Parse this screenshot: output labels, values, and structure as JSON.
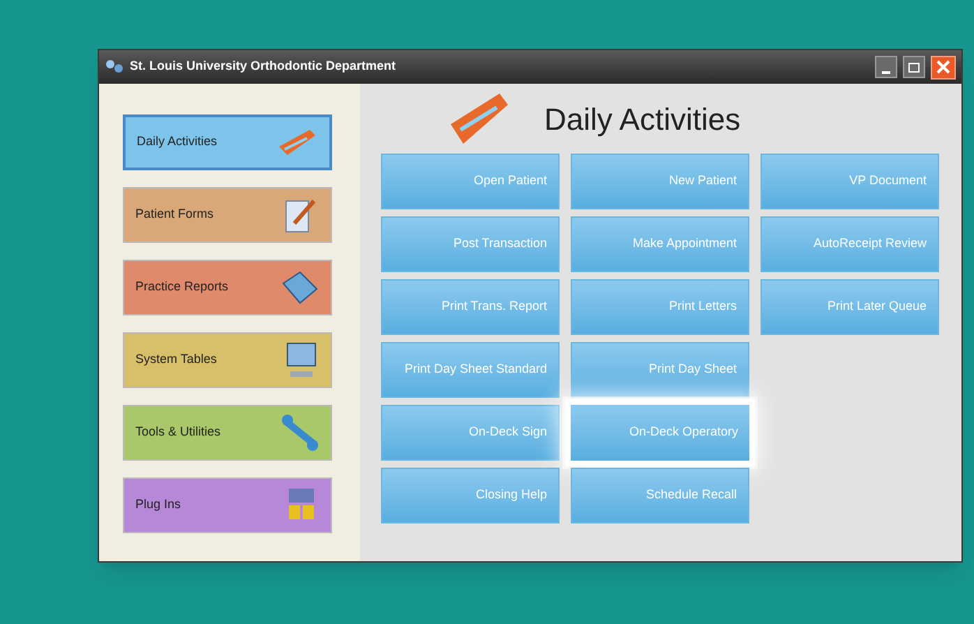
{
  "window": {
    "title": "St. Louis University Orthodontic Department"
  },
  "sidebar": {
    "items": [
      {
        "label": "Daily Activities",
        "color": "#7ec4ea",
        "selected": true
      },
      {
        "label": "Patient Forms",
        "color": "#d9a878",
        "selected": false
      },
      {
        "label": "Practice Reports",
        "color": "#df8a6a",
        "selected": false
      },
      {
        "label": "System Tables",
        "color": "#d8c06a",
        "selected": false
      },
      {
        "label": "Tools & Utilities",
        "color": "#a8c86a",
        "selected": false
      },
      {
        "label": "Plug Ins",
        "color": "#b888d8",
        "selected": false
      }
    ]
  },
  "content": {
    "title": "Daily Activities",
    "button_rows": [
      [
        {
          "label": "Open Patient",
          "highlighted": false
        },
        {
          "label": "New Patient",
          "highlighted": false
        },
        {
          "label": "VP Document",
          "highlighted": false
        }
      ],
      [
        {
          "label": "Post Transaction",
          "highlighted": false
        },
        {
          "label": "Make Appointment",
          "highlighted": false
        },
        {
          "label": "AutoReceipt Review",
          "highlighted": false
        }
      ],
      [
        {
          "label": "Print Trans. Report",
          "highlighted": false
        },
        {
          "label": "Print Letters",
          "highlighted": false
        },
        {
          "label": "Print Later Queue",
          "highlighted": false
        }
      ],
      [
        {
          "label": "Print Day Sheet Standard",
          "highlighted": false
        },
        {
          "label": "Print Day Sheet",
          "highlighted": false
        }
      ],
      [
        {
          "label": "On-Deck Sign",
          "highlighted": false
        },
        {
          "label": "On-Deck Operatory",
          "highlighted": true
        }
      ],
      [
        {
          "label": "Closing Help",
          "highlighted": false
        },
        {
          "label": "Schedule Recall",
          "highlighted": false
        }
      ]
    ]
  }
}
